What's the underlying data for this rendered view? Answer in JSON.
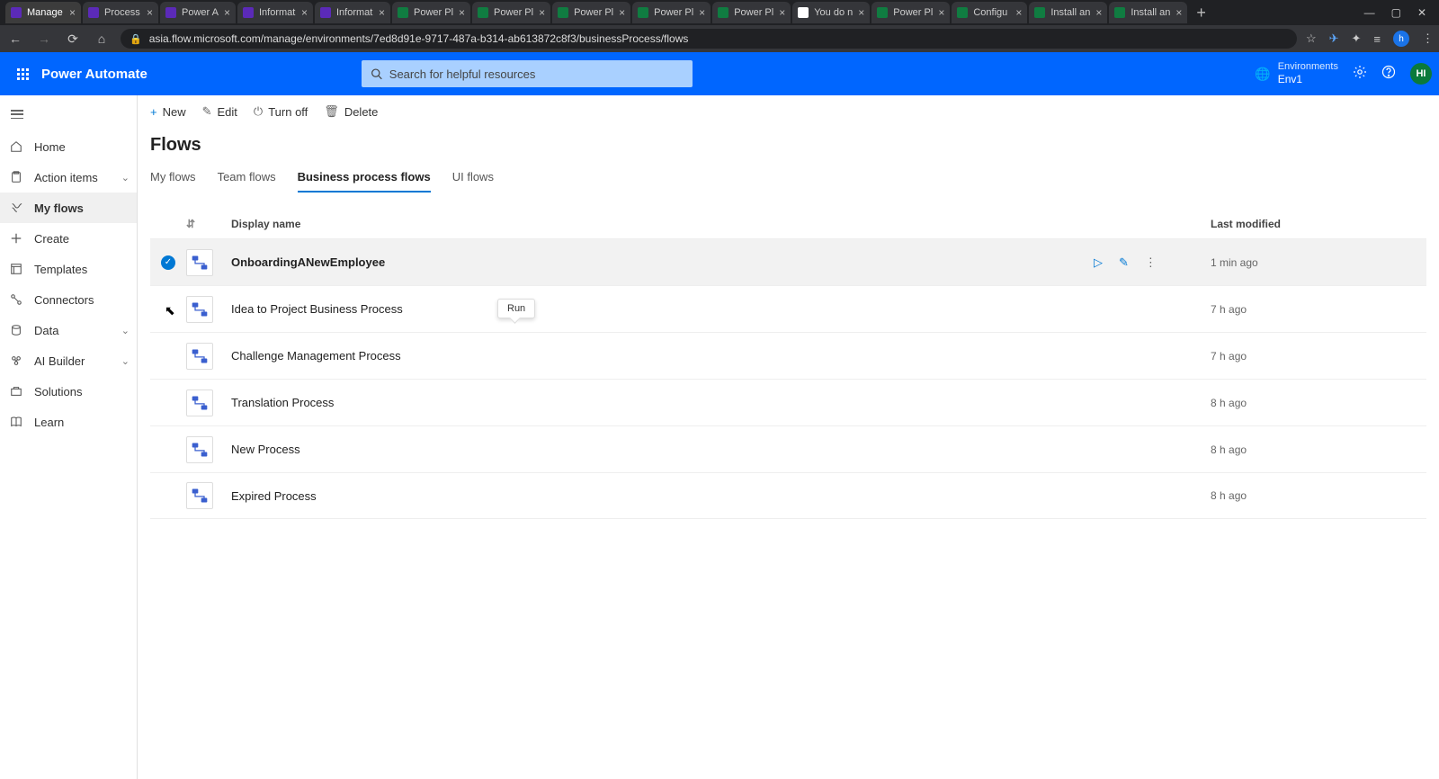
{
  "browser": {
    "tabs": [
      {
        "title": "Manage",
        "favicon": "#5b2ab8"
      },
      {
        "title": "Process",
        "favicon": "#5b2ab8"
      },
      {
        "title": "Power A",
        "favicon": "#5b2ab8"
      },
      {
        "title": "Informat",
        "favicon": "#5b2ab8"
      },
      {
        "title": "Informat",
        "favicon": "#5b2ab8"
      },
      {
        "title": "Power Pl",
        "favicon": "#107c41"
      },
      {
        "title": "Power Pl",
        "favicon": "#107c41"
      },
      {
        "title": "Power Pl",
        "favicon": "#107c41"
      },
      {
        "title": "Power Pl",
        "favicon": "#107c41"
      },
      {
        "title": "Power Pl",
        "favicon": "#107c41"
      },
      {
        "title": "You do n",
        "favicon": "#ffffff"
      },
      {
        "title": "Power Pl",
        "favicon": "#107c41"
      },
      {
        "title": "Configu",
        "favicon": "#107c41"
      },
      {
        "title": "Install an",
        "favicon": "#107c41"
      },
      {
        "title": "Install an",
        "favicon": "#107c41"
      }
    ],
    "url": "asia.flow.microsoft.com/manage/environments/7ed8d91e-9717-487a-b314-ab613872c8f3/businessProcess/flows",
    "profile_initial": "h"
  },
  "header": {
    "app_name": "Power Automate",
    "search_placeholder": "Search for helpful resources",
    "env_label": "Environments",
    "env_name": "Env1",
    "avatar": "HI"
  },
  "sidebar": {
    "items": [
      {
        "label": "Home",
        "icon": "home"
      },
      {
        "label": "Action items",
        "icon": "clipboard",
        "expandable": true
      },
      {
        "label": "My flows",
        "icon": "flow",
        "active": true
      },
      {
        "label": "Create",
        "icon": "plus"
      },
      {
        "label": "Templates",
        "icon": "template"
      },
      {
        "label": "Connectors",
        "icon": "connector"
      },
      {
        "label": "Data",
        "icon": "data",
        "expandable": true
      },
      {
        "label": "AI Builder",
        "icon": "ai",
        "expandable": true
      },
      {
        "label": "Solutions",
        "icon": "solutions"
      },
      {
        "label": "Learn",
        "icon": "book"
      }
    ]
  },
  "commandbar": {
    "new": "New",
    "edit": "Edit",
    "turnoff": "Turn off",
    "delete": "Delete"
  },
  "page": {
    "title": "Flows",
    "tabs": [
      {
        "label": "My flows"
      },
      {
        "label": "Team flows"
      },
      {
        "label": "Business process flows",
        "active": true
      },
      {
        "label": "UI flows"
      }
    ]
  },
  "table": {
    "col_name": "Display name",
    "col_modified": "Last modified",
    "tooltip_run": "Run",
    "rows": [
      {
        "name": "OnboardingANewEmployee",
        "modified": "1 min ago",
        "selected": true
      },
      {
        "name": "Idea to Project Business Process",
        "modified": "7 h ago"
      },
      {
        "name": "Challenge Management Process",
        "modified": "7 h ago"
      },
      {
        "name": "Translation Process",
        "modified": "8 h ago"
      },
      {
        "name": "New Process",
        "modified": "8 h ago"
      },
      {
        "name": "Expired Process",
        "modified": "8 h ago"
      }
    ]
  }
}
